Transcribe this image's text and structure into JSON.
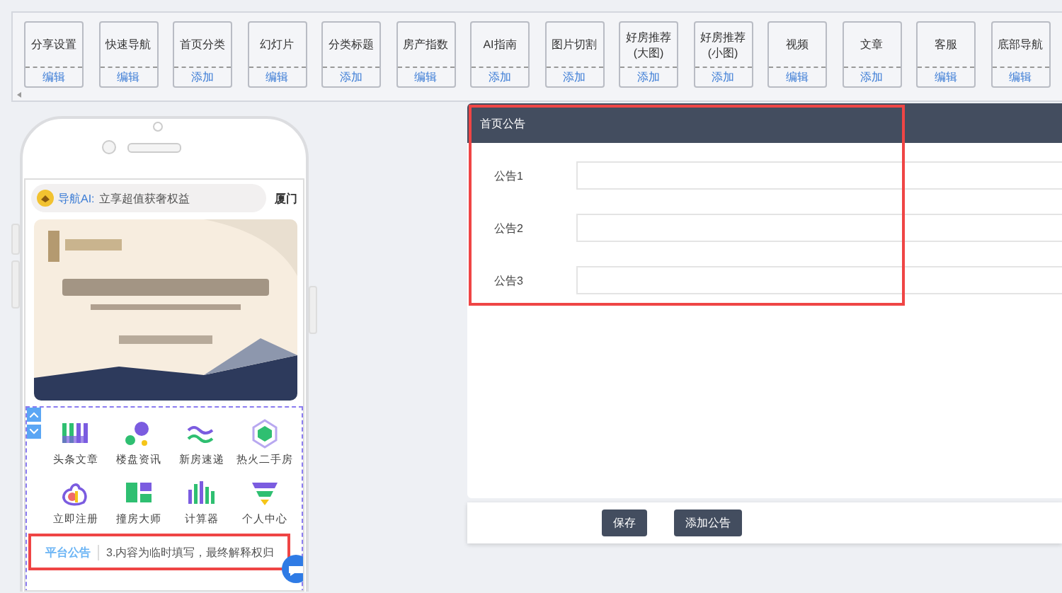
{
  "modules": [
    {
      "label": "分享设置",
      "action": "编辑"
    },
    {
      "label": "快速导航",
      "action": "编辑"
    },
    {
      "label": "首页分类",
      "action": "添加"
    },
    {
      "label": "幻灯片",
      "action": "编辑"
    },
    {
      "label": "分类标题",
      "action": "添加"
    },
    {
      "label": "房产指数",
      "action": "编辑"
    },
    {
      "label": "AI指南",
      "action": "添加"
    },
    {
      "label": "图片切割",
      "action": "添加"
    },
    {
      "label": "好房推荐",
      "sub": "(大图)",
      "action": "添加"
    },
    {
      "label": "好房推荐",
      "sub": "(小图)",
      "action": "添加"
    },
    {
      "label": "视频",
      "action": "编辑"
    },
    {
      "label": "文章",
      "action": "添加"
    },
    {
      "label": "客服",
      "action": "编辑"
    },
    {
      "label": "底部导航",
      "action": "编辑"
    }
  ],
  "phone": {
    "search": {
      "prefix": "导航AI:",
      "text": "立享超值获奢权益"
    },
    "city": "厦门",
    "nav": [
      {
        "label": "头条文章"
      },
      {
        "label": "楼盘资讯"
      },
      {
        "label": "新房速递"
      },
      {
        "label": "热火二手房"
      },
      {
        "label": "立即注册"
      },
      {
        "label": "撞房大师"
      },
      {
        "label": "计算器"
      },
      {
        "label": "个人中心"
      }
    ],
    "notice": {
      "title": "平台公告",
      "text": "3.内容为临时填写，最终解释权归",
      "highlighted": true
    }
  },
  "panel": {
    "title": "首页公告",
    "highlighted": true,
    "fields": [
      {
        "label": "公告1"
      },
      {
        "label": "公告2"
      },
      {
        "label": "公告3"
      }
    ],
    "buttons": [
      "保存",
      "添加公告"
    ]
  }
}
